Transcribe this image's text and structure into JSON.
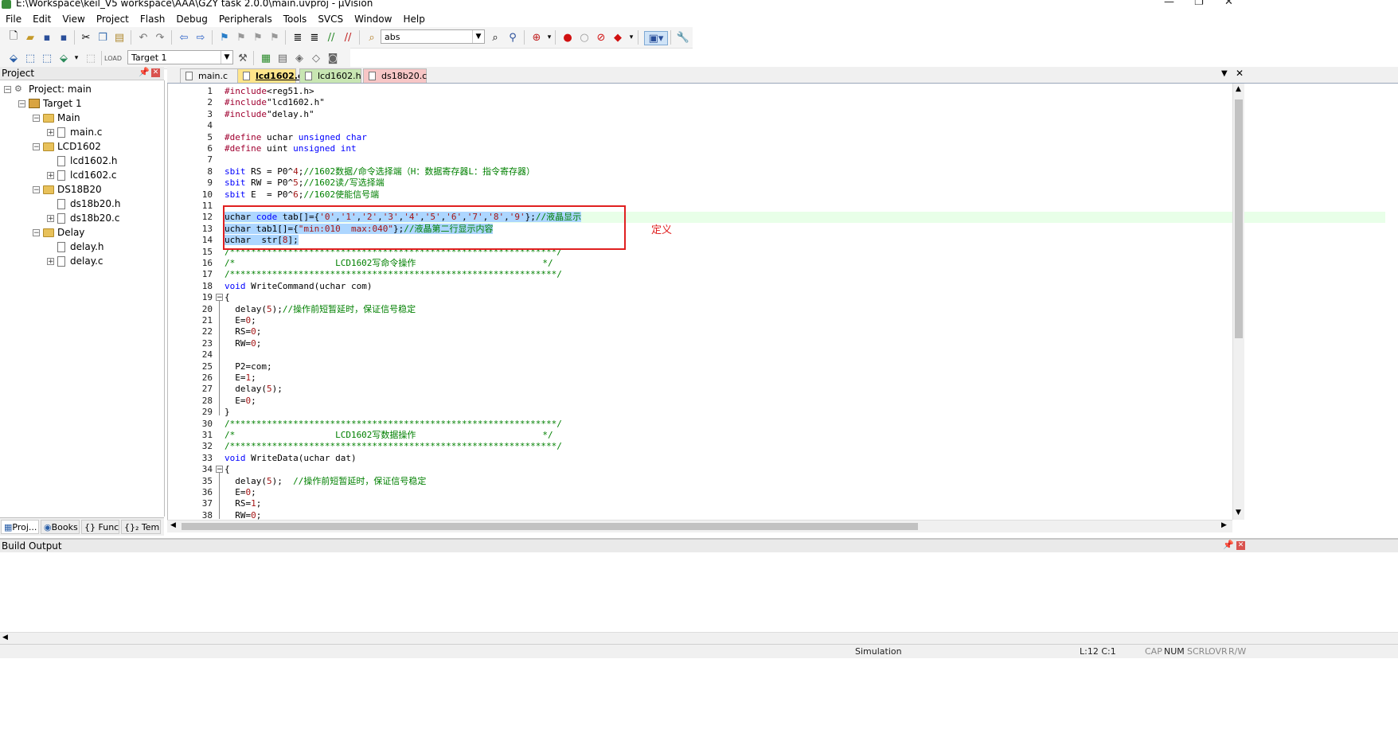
{
  "window": {
    "title": "E:\\Workspace\\keil_V5 workspace\\AAA\\GZY task 2.0.0\\main.uvproj - µVision"
  },
  "menu": [
    "File",
    "Edit",
    "View",
    "Project",
    "Flash",
    "Debug",
    "Peripherals",
    "Tools",
    "SVCS",
    "Window",
    "Help"
  ],
  "toolbar": {
    "find_text": "abs",
    "target": "Target 1"
  },
  "project_panel": {
    "title": "Project",
    "tree": {
      "root": "Project: main",
      "target": "Target 1",
      "groups": [
        {
          "name": "Main",
          "files": [
            "main.c"
          ]
        },
        {
          "name": "LCD1602",
          "files": [
            "lcd1602.h",
            "lcd1602.c"
          ]
        },
        {
          "name": "DS18B20",
          "files": [
            "ds18b20.h",
            "ds18b20.c"
          ]
        },
        {
          "name": "Delay",
          "files": [
            "delay.h",
            "delay.c"
          ]
        }
      ]
    },
    "tabs": [
      "Proj...",
      "Books",
      "{} Func...",
      "{}₂ Tem..."
    ]
  },
  "editor": {
    "tabs": [
      {
        "label": "main.c",
        "color": "#f0f0f0"
      },
      {
        "label": "lcd1602.c",
        "color": "#ffe58a"
      },
      {
        "label": "lcd1602.h",
        "color": "#c8e6b2"
      },
      {
        "label": "ds18b20.c",
        "color": "#f7c6c6"
      }
    ],
    "active_tab": "lcd1602.c",
    "annotation": "定义",
    "lines": [
      "#include<reg51.h>",
      "#include\"lcd1602.h\"",
      "#include\"delay.h\"",
      "",
      "#define uchar unsigned char",
      "#define uint unsigned int",
      "",
      "sbit RS = P0^4;//1602数据/命令选择端（H：数据寄存器L：指令寄存器）",
      "sbit RW = P0^5;//1602读/写选择端",
      "sbit E  = P0^6;//1602使能信号端",
      "",
      "uchar code tab[]={'0','1','2','3','4','5','6','7','8','9'};//液晶显示",
      "uchar tab1[]={\"min:010  max:040\"};//液晶第二行显示内容",
      "uchar  str[8];",
      "/**************************************************************/",
      "/*                   LCD1602写命令操作                        */",
      "/**************************************************************/",
      "void WriteCommand(uchar com)",
      "{",
      "  delay(5);//操作前短暂延时，保证信号稳定",
      "  E=0;",
      "  RS=0;",
      "  RW=0;",
      "",
      "  P2=com;",
      "  E=1;",
      "  delay(5);",
      "  E=0;",
      "}",
      "/**************************************************************/",
      "/*                   LCD1602写数据操作                        */",
      "/**************************************************************/",
      "void WriteData(uchar dat)",
      "{",
      "  delay(5);  //操作前短暂延时，保证信号稳定",
      "  E=0;",
      "  RS=1;",
      "  RW=0;"
    ]
  },
  "build_output": {
    "title": "Build Output"
  },
  "status": {
    "mode": "Simulation",
    "position": "L:12 C:1",
    "caps": "CAP",
    "num": "NUM",
    "scrl": "SCRL",
    "ovr": "OVR",
    "rw": "R/W"
  }
}
